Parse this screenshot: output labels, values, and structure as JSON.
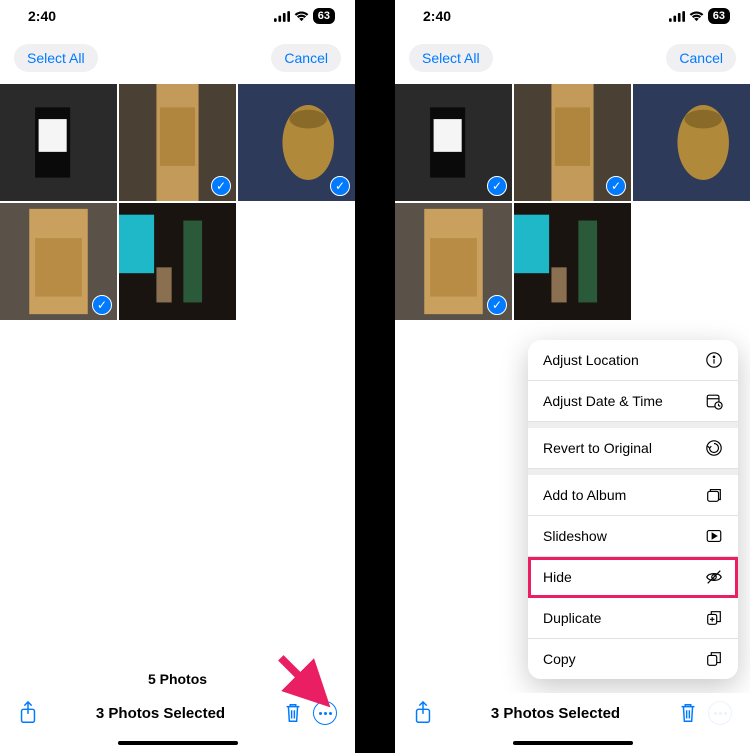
{
  "status": {
    "time": "2:40",
    "battery": "63"
  },
  "topbar": {
    "select_all": "Select All",
    "cancel": "Cancel"
  },
  "left": {
    "count_line": "5 Photos",
    "selected_line": "3 Photos Selected"
  },
  "right": {
    "selected_line": "3 Photos Selected"
  },
  "menu": {
    "adjust_location": "Adjust Location",
    "adjust_date": "Adjust Date & Time",
    "revert": "Revert to Original",
    "add_album": "Add to Album",
    "slideshow": "Slideshow",
    "hide": "Hide",
    "duplicate": "Duplicate",
    "copy": "Copy"
  },
  "thumbs": {
    "left": [
      {
        "selected": false
      },
      {
        "selected": true
      },
      {
        "selected": true
      },
      {
        "selected": true
      },
      {
        "selected": false
      }
    ],
    "right": [
      {
        "selected": true
      },
      {
        "selected": true
      },
      {
        "selected": false
      },
      {
        "selected": true
      },
      {
        "selected": false
      }
    ]
  }
}
